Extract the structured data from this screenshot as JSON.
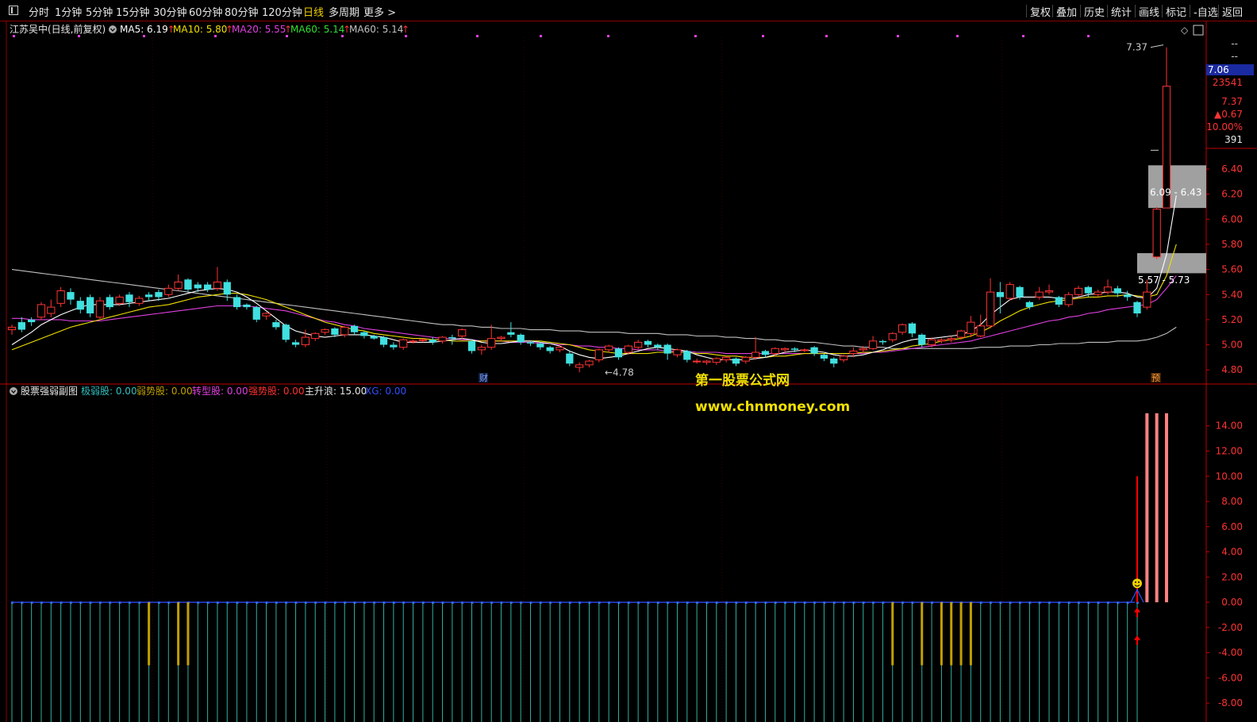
{
  "toolbar": {
    "left": [
      "分时",
      "1分钟",
      "5分钟",
      "15分钟",
      "30分钟",
      "60分钟",
      "80分钟",
      "120分钟",
      "日线",
      "多周期",
      "更多 >"
    ],
    "active": "日线",
    "right": [
      "复权",
      "叠加",
      "历史",
      "统计",
      "画线",
      "标记",
      "-自选",
      "返回"
    ]
  },
  "main_header": {
    "stock_label": "江苏吴中(日线,前复权)",
    "ma": [
      {
        "label": "MA5: 6.19",
        "color": "#ffffff"
      },
      {
        "label": "MA10: 5.80",
        "color": "#f0e000"
      },
      {
        "label": "MA20: 5.55",
        "color": "#e040e0"
      },
      {
        "label": "MA60: 5.14",
        "color": "#30e030"
      },
      {
        "label": "MA60: 5.14",
        "color": "#c0c0c0"
      }
    ],
    "arrow": "↑"
  },
  "quote_panel": {
    "dash1": "--",
    "dash2": "--",
    "price": "7.06",
    "volume": "23541",
    "high": "7.37",
    "change": "▲0.67",
    "pct": "10.00%",
    "amount": "391"
  },
  "annotations": {
    "high_label": "7.37",
    "low_label": "←4.78",
    "cai": "财",
    "yu": "预",
    "zone_upper": "6.09 - 6.43",
    "zone_lower": "5.57 - 5.73"
  },
  "watermark": {
    "title": "第一股票公式网",
    "url": "www.chnmoney.com"
  },
  "sub_header": {
    "name": "股票强弱副图",
    "items": [
      {
        "label": "极弱股: 0.00",
        "color": "#30c0c0"
      },
      {
        "label": "弱势股: 0.00",
        "color": "#c0a000"
      },
      {
        "label": "转型股: 0.00",
        "color": "#e040e0"
      },
      {
        "label": "强势股: 0.00",
        "color": "#ff3030"
      },
      {
        "label": "主升浪: 15.00",
        "color": "#e6e6e6"
      },
      {
        "label": "XG: 0.00",
        "color": "#3050ff"
      }
    ]
  },
  "colors": {
    "up": "#ff3333",
    "down": "#40e0e0",
    "ma5": "#ffffff",
    "ma10": "#f0e000",
    "ma20": "#e040e0",
    "ma60": "#c0c0c0",
    "axis": "#c00000",
    "zone": "#a0a0a0",
    "weak": "#c0a000",
    "veryweak": "#30b0a0",
    "main": "#ff8080",
    "signal": "#ff0000",
    "xg": "#3050ff"
  },
  "chart_data": [
    {
      "type": "candlestick",
      "title": "江苏吴中(日线,前复权)",
      "ylim": [
        4.7,
        7.45
      ],
      "yticks": [
        4.8,
        5.0,
        5.2,
        5.4,
        5.6,
        5.8,
        6.0,
        6.2,
        6.4
      ],
      "candles": [
        [
          5.12,
          5.14,
          5.08,
          5.16
        ],
        [
          5.18,
          5.12,
          5.1,
          5.22
        ],
        [
          5.2,
          5.18,
          5.15,
          5.22
        ],
        [
          5.22,
          5.32,
          5.2,
          5.34
        ],
        [
          5.25,
          5.3,
          5.22,
          5.36
        ],
        [
          5.33,
          5.43,
          5.3,
          5.46
        ],
        [
          5.42,
          5.36,
          5.32,
          5.45
        ],
        [
          5.35,
          5.28,
          5.25,
          5.38
        ],
        [
          5.38,
          5.25,
          5.22,
          5.4
        ],
        [
          5.22,
          5.35,
          5.2,
          5.38
        ],
        [
          5.38,
          5.3,
          5.28,
          5.4
        ],
        [
          5.33,
          5.38,
          5.31,
          5.4
        ],
        [
          5.4,
          5.34,
          5.3,
          5.42
        ],
        [
          5.33,
          5.37,
          5.31,
          5.39
        ],
        [
          5.4,
          5.38,
          5.35,
          5.42
        ],
        [
          5.42,
          5.38,
          5.35,
          5.44
        ],
        [
          5.4,
          5.45,
          5.38,
          5.48
        ],
        [
          5.45,
          5.5,
          5.43,
          5.56
        ],
        [
          5.52,
          5.44,
          5.42,
          5.53
        ],
        [
          5.48,
          5.45,
          5.42,
          5.5
        ],
        [
          5.48,
          5.44,
          5.42,
          5.5
        ],
        [
          5.45,
          5.5,
          5.43,
          5.62
        ],
        [
          5.5,
          5.4,
          5.35,
          5.52
        ],
        [
          5.38,
          5.3,
          5.28,
          5.4
        ],
        [
          5.32,
          5.3,
          5.28,
          5.33
        ],
        [
          5.3,
          5.2,
          5.18,
          5.31
        ],
        [
          5.23,
          5.25,
          5.2,
          5.26
        ],
        [
          5.18,
          5.14,
          5.12,
          5.2
        ],
        [
          5.16,
          5.04,
          5.02,
          5.17
        ],
        [
          5.02,
          5.0,
          4.98,
          5.04
        ],
        [
          5.0,
          5.06,
          4.98,
          5.12
        ],
        [
          5.05,
          5.09,
          5.03,
          5.1
        ],
        [
          5.1,
          5.12,
          5.08,
          5.13
        ],
        [
          5.13,
          5.08,
          5.06,
          5.14
        ],
        [
          5.08,
          5.14,
          5.06,
          5.15
        ],
        [
          5.15,
          5.1,
          5.08,
          5.16
        ],
        [
          5.1,
          5.07,
          5.05,
          5.11
        ],
        [
          5.07,
          5.05,
          5.04,
          5.08
        ],
        [
          5.06,
          5.0,
          4.98,
          5.07
        ],
        [
          5.0,
          4.98,
          4.96,
          5.02
        ],
        [
          4.98,
          5.04,
          4.96,
          5.05
        ],
        [
          5.03,
          5.03,
          5.01,
          5.04
        ],
        [
          5.04,
          5.04,
          5.02,
          5.05
        ],
        [
          5.04,
          5.02,
          5.0,
          5.06
        ],
        [
          5.03,
          5.06,
          5.01,
          5.07
        ],
        [
          5.06,
          5.05,
          5.0,
          5.08
        ],
        [
          5.07,
          5.12,
          5.04,
          5.13
        ],
        [
          5.03,
          4.95,
          4.93,
          5.04
        ],
        [
          4.96,
          4.98,
          4.92,
          5.0
        ],
        [
          4.98,
          5.05,
          4.96,
          5.16
        ],
        [
          5.05,
          5.06,
          5.03,
          5.07
        ],
        [
          5.1,
          5.08,
          5.06,
          5.18
        ],
        [
          5.08,
          5.02,
          5.0,
          5.09
        ],
        [
          5.02,
          5.01,
          4.99,
          5.03
        ],
        [
          5.01,
          4.98,
          4.96,
          5.02
        ],
        [
          4.98,
          4.95,
          4.93,
          4.99
        ],
        [
          4.96,
          4.98,
          4.94,
          5.0
        ],
        [
          4.93,
          4.85,
          4.83,
          4.95
        ],
        [
          4.82,
          4.84,
          4.78,
          4.86
        ],
        [
          4.84,
          4.87,
          4.82,
          4.88
        ],
        [
          4.88,
          4.96,
          4.86,
          4.97
        ],
        [
          4.96,
          4.99,
          4.94,
          5.0
        ],
        [
          4.97,
          4.9,
          4.88,
          4.98
        ],
        [
          4.94,
          4.99,
          4.92,
          5.0
        ],
        [
          4.98,
          5.02,
          4.96,
          5.04
        ],
        [
          5.03,
          5.0,
          4.98,
          5.04
        ],
        [
          5.0,
          4.98,
          4.96,
          5.01
        ],
        [
          5.0,
          4.93,
          4.88,
          5.01
        ],
        [
          4.92,
          4.96,
          4.9,
          4.97
        ],
        [
          4.95,
          4.88,
          4.86,
          4.96
        ],
        [
          4.87,
          4.87,
          4.85,
          4.89
        ],
        [
          4.86,
          4.87,
          4.84,
          4.88
        ],
        [
          4.86,
          4.89,
          4.84,
          4.9
        ],
        [
          4.88,
          4.9,
          4.86,
          4.91
        ],
        [
          4.89,
          4.85,
          4.83,
          4.9
        ],
        [
          4.87,
          4.9,
          4.85,
          4.91
        ],
        [
          4.9,
          4.94,
          4.88,
          5.06
        ],
        [
          4.95,
          4.92,
          4.9,
          4.96
        ],
        [
          4.93,
          4.97,
          4.91,
          4.98
        ],
        [
          4.96,
          4.97,
          4.94,
          4.98
        ],
        [
          4.97,
          4.96,
          4.94,
          4.98
        ],
        [
          4.96,
          4.96,
          4.94,
          4.97
        ],
        [
          4.98,
          4.93,
          4.91,
          4.99
        ],
        [
          4.92,
          4.89,
          4.87,
          4.93
        ],
        [
          4.89,
          4.85,
          4.82,
          4.9
        ],
        [
          4.88,
          4.91,
          4.86,
          4.92
        ],
        [
          4.93,
          4.95,
          4.9,
          4.98
        ],
        [
          4.96,
          4.97,
          4.94,
          4.99
        ],
        [
          4.97,
          5.03,
          4.96,
          5.07
        ],
        [
          5.03,
          5.02,
          5.0,
          5.04
        ],
        [
          5.04,
          5.09,
          5.02,
          5.1
        ],
        [
          5.1,
          5.16,
          5.08,
          5.17
        ],
        [
          5.17,
          5.09,
          5.06,
          5.18
        ],
        [
          5.08,
          5.0,
          4.98,
          5.09
        ],
        [
          5.0,
          5.04,
          4.98,
          5.06
        ],
        [
          5.03,
          5.04,
          5.01,
          5.05
        ],
        [
          5.04,
          5.05,
          5.02,
          5.07
        ],
        [
          5.06,
          5.11,
          5.04,
          5.12
        ],
        [
          5.09,
          5.18,
          5.06,
          5.23
        ],
        [
          5.07,
          5.15,
          5.06,
          5.24
        ],
        [
          5.15,
          5.42,
          5.13,
          5.53
        ],
        [
          5.42,
          5.38,
          5.25,
          5.5
        ],
        [
          5.37,
          5.48,
          5.35,
          5.5
        ],
        [
          5.46,
          5.38,
          5.36,
          5.47
        ],
        [
          5.34,
          5.3,
          5.28,
          5.35
        ],
        [
          5.38,
          5.42,
          5.36,
          5.46
        ],
        [
          5.42,
          5.43,
          5.4,
          5.48
        ],
        [
          5.38,
          5.32,
          5.3,
          5.39
        ],
        [
          5.32,
          5.4,
          5.3,
          5.42
        ],
        [
          5.4,
          5.45,
          5.38,
          5.47
        ],
        [
          5.46,
          5.41,
          5.38,
          5.47
        ],
        [
          5.4,
          5.42,
          5.38,
          5.44
        ],
        [
          5.42,
          5.46,
          5.4,
          5.52
        ],
        [
          5.45,
          5.41,
          5.38,
          5.47
        ],
        [
          5.4,
          5.38,
          5.35,
          5.43
        ],
        [
          5.34,
          5.25,
          5.22,
          5.35
        ],
        [
          5.3,
          5.42,
          5.28,
          5.52
        ],
        [
          5.7,
          6.08,
          5.68,
          6.1
        ],
        [
          6.09,
          7.06,
          6.55,
          7.37
        ]
      ],
      "ma5": [
        5.0,
        5.05,
        5.1,
        5.16,
        5.2,
        5.24,
        5.27,
        5.3,
        5.32,
        5.32,
        5.32,
        5.32,
        5.33,
        5.34,
        5.35,
        5.36,
        5.37,
        5.39,
        5.41,
        5.43,
        5.44,
        5.45,
        5.44,
        5.42,
        5.38,
        5.33,
        5.27,
        5.21,
        5.15,
        5.11,
        5.09,
        5.07,
        5.06,
        5.07,
        5.08,
        5.08,
        5.08,
        5.07,
        5.06,
        5.04,
        5.02,
        5.02,
        5.02,
        5.02,
        5.03,
        5.04,
        5.05,
        5.04,
        5.02,
        5.01,
        5.01,
        5.02,
        5.03,
        5.03,
        5.02,
        5.01,
        4.99,
        4.95,
        4.92,
        4.9,
        4.89,
        4.9,
        4.91,
        4.93,
        4.95,
        4.97,
        4.98,
        4.97,
        4.96,
        4.95,
        4.92,
        4.9,
        4.88,
        4.88,
        4.88,
        4.88,
        4.89,
        4.9,
        4.92,
        4.94,
        4.95,
        4.96,
        4.95,
        4.94,
        4.92,
        4.91,
        4.91,
        4.92,
        4.94,
        4.96,
        4.99,
        5.02,
        5.04,
        5.05,
        5.05,
        5.06,
        5.07,
        5.08,
        5.11,
        5.16,
        5.24,
        5.3,
        5.36,
        5.38,
        5.38,
        5.38,
        5.38,
        5.37,
        5.37,
        5.38,
        5.4,
        5.41,
        5.42,
        5.42,
        5.41,
        5.38,
        5.37,
        5.45,
        5.72,
        6.19
      ],
      "ma10": [
        4.96,
        4.99,
        5.02,
        5.05,
        5.08,
        5.11,
        5.14,
        5.16,
        5.18,
        5.2,
        5.22,
        5.24,
        5.26,
        5.28,
        5.3,
        5.31,
        5.32,
        5.34,
        5.36,
        5.38,
        5.39,
        5.4,
        5.41,
        5.41,
        5.4,
        5.38,
        5.36,
        5.33,
        5.3,
        5.27,
        5.24,
        5.21,
        5.18,
        5.16,
        5.14,
        5.12,
        5.11,
        5.09,
        5.08,
        5.07,
        5.06,
        5.05,
        5.05,
        5.04,
        5.04,
        5.03,
        5.03,
        5.03,
        5.03,
        5.03,
        5.03,
        5.03,
        5.03,
        5.03,
        5.03,
        5.02,
        5.01,
        5.0,
        4.98,
        4.96,
        4.95,
        4.94,
        4.93,
        4.93,
        4.93,
        4.93,
        4.94,
        4.94,
        4.94,
        4.94,
        4.93,
        4.93,
        4.92,
        4.91,
        4.91,
        4.9,
        4.9,
        4.9,
        4.91,
        4.91,
        4.92,
        4.93,
        4.93,
        4.93,
        4.93,
        4.93,
        4.93,
        4.94,
        4.94,
        4.95,
        4.96,
        4.97,
        4.99,
        5.0,
        5.01,
        5.03,
        5.04,
        5.05,
        5.07,
        5.1,
        5.14,
        5.19,
        5.23,
        5.27,
        5.3,
        5.32,
        5.34,
        5.35,
        5.36,
        5.37,
        5.38,
        5.38,
        5.39,
        5.39,
        5.4,
        5.39,
        5.38,
        5.4,
        5.55,
        5.8
      ],
      "ma20": [
        5.21,
        5.21,
        5.2,
        5.2,
        5.2,
        5.2,
        5.19,
        5.19,
        5.19,
        5.19,
        5.2,
        5.21,
        5.22,
        5.23,
        5.24,
        5.25,
        5.26,
        5.27,
        5.28,
        5.29,
        5.3,
        5.31,
        5.31,
        5.31,
        5.31,
        5.3,
        5.29,
        5.28,
        5.27,
        5.25,
        5.23,
        5.21,
        5.19,
        5.18,
        5.16,
        5.15,
        5.13,
        5.12,
        5.11,
        5.1,
        5.09,
        5.08,
        5.07,
        5.06,
        5.05,
        5.05,
        5.04,
        5.04,
        5.03,
        5.03,
        5.03,
        5.02,
        5.02,
        5.02,
        5.01,
        5.01,
        5.0,
        5.0,
        4.99,
        4.99,
        4.98,
        4.98,
        4.97,
        4.97,
        4.96,
        4.96,
        4.96,
        4.95,
        4.95,
        4.95,
        4.94,
        4.94,
        4.94,
        4.93,
        4.93,
        4.93,
        4.93,
        4.93,
        4.93,
        4.93,
        4.93,
        4.93,
        4.93,
        4.93,
        4.93,
        4.93,
        4.93,
        4.93,
        4.94,
        4.94,
        4.95,
        4.96,
        4.97,
        4.98,
        4.99,
        5.0,
        5.01,
        5.02,
        5.03,
        5.05,
        5.07,
        5.09,
        5.11,
        5.13,
        5.15,
        5.17,
        5.19,
        5.2,
        5.22,
        5.23,
        5.25,
        5.26,
        5.28,
        5.29,
        5.3,
        5.31,
        5.32,
        5.36,
        5.45,
        5.55
      ],
      "ma60": [
        5.6,
        5.59,
        5.58,
        5.57,
        5.56,
        5.55,
        5.54,
        5.53,
        5.52,
        5.51,
        5.5,
        5.49,
        5.48,
        5.47,
        5.46,
        5.45,
        5.44,
        5.43,
        5.42,
        5.41,
        5.4,
        5.39,
        5.38,
        5.37,
        5.36,
        5.35,
        5.34,
        5.33,
        5.32,
        5.31,
        5.3,
        5.29,
        5.28,
        5.27,
        5.26,
        5.25,
        5.24,
        5.23,
        5.22,
        5.21,
        5.2,
        5.19,
        5.18,
        5.17,
        5.16,
        5.16,
        5.15,
        5.15,
        5.14,
        5.14,
        5.13,
        5.13,
        5.13,
        5.12,
        5.12,
        5.12,
        5.11,
        5.11,
        5.11,
        5.1,
        5.1,
        5.1,
        5.1,
        5.09,
        5.09,
        5.09,
        5.09,
        5.08,
        5.08,
        5.08,
        5.07,
        5.07,
        5.07,
        5.06,
        5.06,
        5.05,
        5.05,
        5.04,
        5.04,
        5.03,
        5.03,
        5.02,
        5.02,
        5.01,
        5.0,
        4.99,
        4.99,
        4.98,
        4.98,
        4.98,
        4.97,
        4.97,
        4.97,
        4.97,
        4.97,
        4.97,
        4.97,
        4.97,
        4.97,
        4.98,
        4.98,
        4.98,
        4.99,
        4.99,
        4.99,
        5.0,
        5.0,
        5.01,
        5.01,
        5.01,
        5.02,
        5.02,
        5.02,
        5.03,
        5.03,
        5.03,
        5.04,
        5.06,
        5.09,
        5.14
      ],
      "zones": [
        [
          6.09,
          6.43
        ],
        [
          5.57,
          5.73
        ]
      ]
    },
    {
      "type": "bar",
      "title": "股票强弱副图",
      "ylim": [
        -9.5,
        16.5
      ],
      "yticks": [
        -8,
        -6,
        -4,
        -2,
        0,
        2,
        4,
        6,
        8,
        10,
        12,
        14
      ],
      "series": [
        {
          "name": "弱势股",
          "values_at": [
            14,
            17,
            18,
            90,
            93,
            95,
            96,
            97,
            98
          ]
        },
        {
          "name": "主升浪",
          "values_at": [
            0,
            1,
            2
          ]
        },
        {
          "name": "强势股",
          "value": 10
        }
      ]
    }
  ]
}
